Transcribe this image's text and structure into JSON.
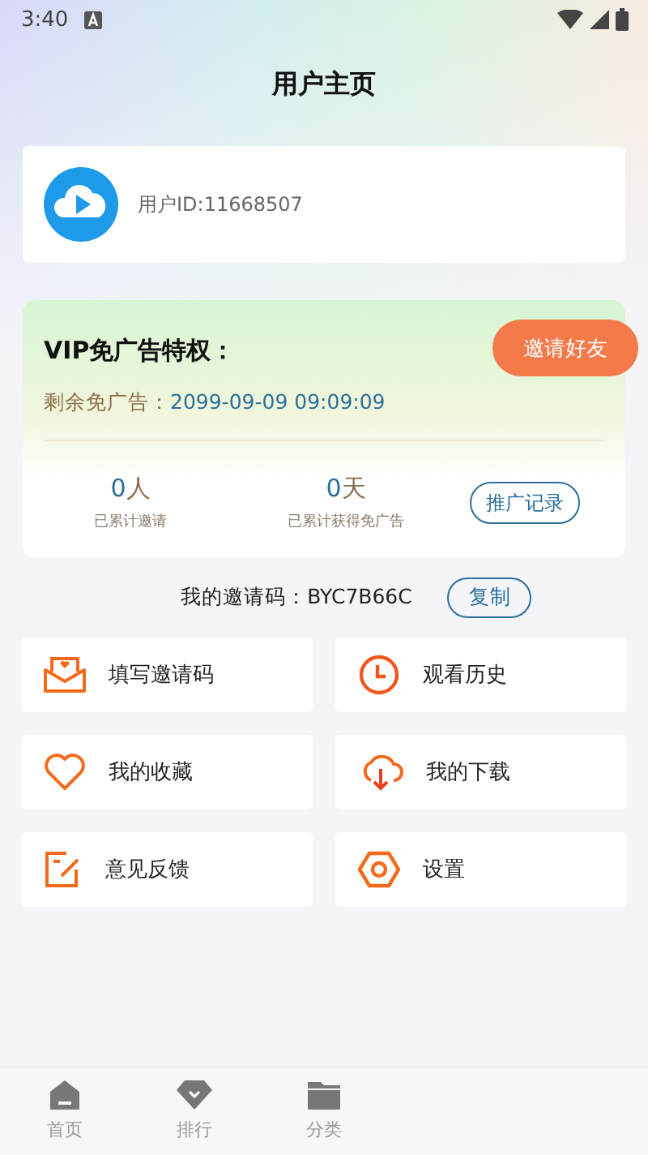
{
  "status_bar": {
    "time": "3:40"
  },
  "title": "用户主页",
  "profile": {
    "user_id": "用户ID:11668507"
  },
  "vip": {
    "title": "VIP免广告特权：",
    "invite_button": "邀请好友",
    "remaining_label": "剩余免广告：",
    "remaining_value": "2099-09-09 09:09:09",
    "stats": [
      {
        "number": "0",
        "unit": "人",
        "label": "已累计邀请"
      },
      {
        "number": "0",
        "unit": "天",
        "label": "已累计获得免广告"
      }
    ],
    "records_button": "推广记录"
  },
  "invite_code": {
    "label": "我的邀请码：BYC7B66C",
    "copy_button": "复制"
  },
  "menu": [
    {
      "kind": "envelope",
      "label": "填写邀请码"
    },
    {
      "kind": "clock",
      "label": "观看历史"
    },
    {
      "kind": "heart",
      "label": "我的收藏"
    },
    {
      "kind": "download",
      "label": "我的下载"
    },
    {
      "kind": "edit",
      "label": "意见反馈"
    },
    {
      "kind": "settings",
      "label": "设置"
    }
  ],
  "bottom_nav": [
    {
      "kind": "home",
      "label": "首页",
      "selected": false
    },
    {
      "kind": "ranking",
      "label": "排行",
      "selected": false
    },
    {
      "kind": "folder",
      "label": "分类",
      "selected": false
    }
  ]
}
